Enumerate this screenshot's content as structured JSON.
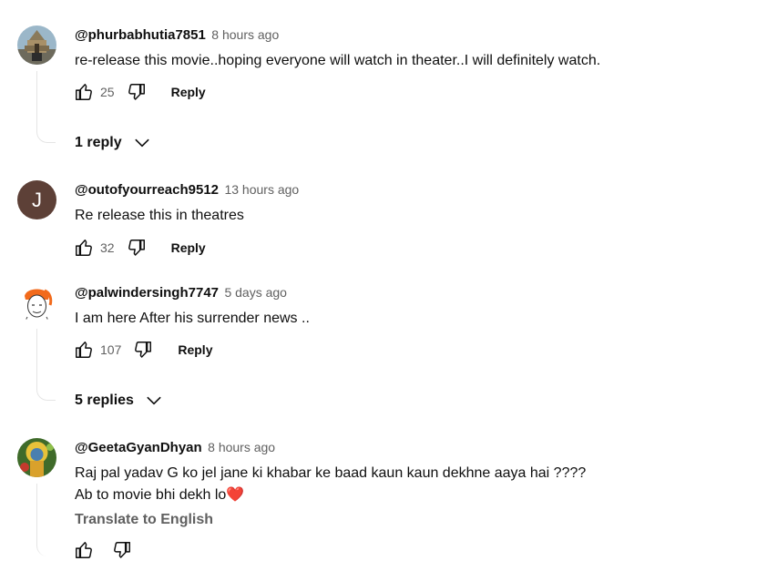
{
  "comments": [
    {
      "handle": "@phurbabhutia7851",
      "time": "8 hours ago",
      "text": "re-release this movie..hoping everyone will watch in theater..I will definitely watch.",
      "likes": "25",
      "reply_label": "Reply",
      "replies_label": "1 reply",
      "avatar_icon": "temple-photo-avatar"
    },
    {
      "handle": "@outofyourreach9512",
      "time": "13 hours ago",
      "text": "Re release this in theatres",
      "likes": "32",
      "reply_label": "Reply",
      "avatar_letter": "J",
      "avatar_color": "#5d4037"
    },
    {
      "handle": "@palwindersingh7747",
      "time": "5 days ago",
      "text": "I am here After his surrender news ..",
      "likes": "107",
      "reply_label": "Reply",
      "replies_label": "5 replies",
      "avatar_icon": "turban-sketch-avatar"
    },
    {
      "handle": "@GeetaGyanDhyan",
      "time": "8 hours ago",
      "text_line1": "Raj pal yadav G ko jel jane ki khabar ke baad kaun kaun dekhne aaya hai ????",
      "text_line2": "Ab to movie bhi dekh lo",
      "heart": "❤️",
      "translate_label": "Translate to English",
      "avatar_icon": "deity-painting-avatar"
    }
  ],
  "colors": {
    "primary_text": "#0f0f0f",
    "secondary_text": "#606060",
    "thread_line": "#e5e5e5"
  }
}
